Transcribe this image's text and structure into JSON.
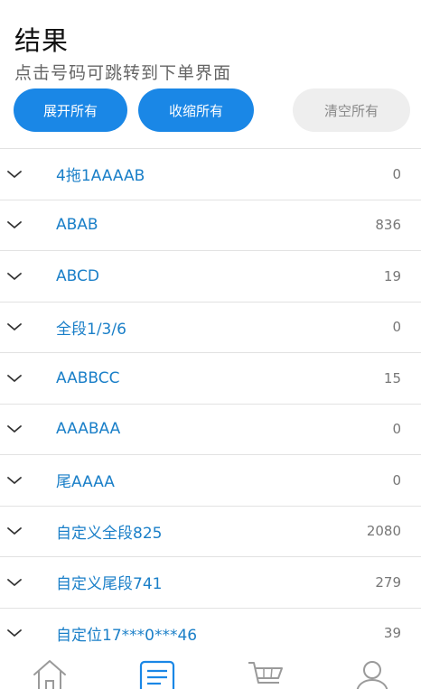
{
  "header": {
    "title": "结果",
    "subtitle": "点击号码可跳转到下单界面"
  },
  "actions": {
    "expand_all": "展开所有",
    "collapse_all": "收缩所有",
    "clear_all": "清空所有"
  },
  "results": [
    {
      "label": "4拖1AAAAB",
      "count": "0"
    },
    {
      "label": "ABAB",
      "count": "836"
    },
    {
      "label": "ABCD",
      "count": "19"
    },
    {
      "label": "全段1/3/6",
      "count": "0"
    },
    {
      "label": "AABBCC",
      "count": "15"
    },
    {
      "label": "AAABAA",
      "count": "0"
    },
    {
      "label": "尾AAAA",
      "count": "0"
    },
    {
      "label": "自定义全段825",
      "count": "2080"
    },
    {
      "label": "自定义尾段741",
      "count": "279"
    },
    {
      "label": "自定位17***0***46",
      "count": "39"
    }
  ],
  "tabbar": {
    "icons": [
      "home-icon",
      "list-icon",
      "cart-icon",
      "user-icon"
    ],
    "active_index": 1,
    "active_color": "#1a87e6",
    "inactive_color": "#9a9a9a"
  },
  "colors": {
    "primary": "#1a87e6",
    "link": "#1a7fc8"
  }
}
